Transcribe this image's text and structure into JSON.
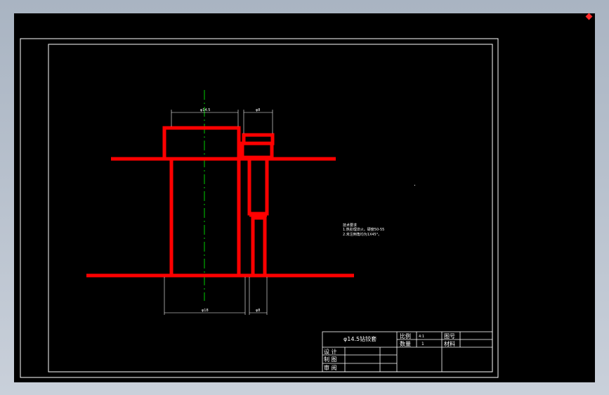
{
  "title_block": {
    "part_name": "φ14.5钻铰套",
    "scale_label": "比例",
    "scale_value": "4:1",
    "drawing_no_label": "图号",
    "quantity_label": "数量",
    "quantity_value": "1",
    "material_label": "材料",
    "design_label": "设  计",
    "draw_label": "制  图",
    "review_label": "审  阅"
  },
  "dimensions": {
    "top_left": "φ14.5",
    "top_right": "φ8",
    "bottom_left": "φ18",
    "bottom_right": "φ8"
  },
  "notes": {
    "heading": "技术要求",
    "line1": "1.热处理淬火。硬度50-55",
    "line2": "2.未注倒角均为1X45°。"
  },
  "colors": {
    "part_outline": "#ff0000",
    "centerline": "#00cc00",
    "frame": "#ffffff",
    "background": "#000000",
    "marker": "#ff2a2a"
  }
}
